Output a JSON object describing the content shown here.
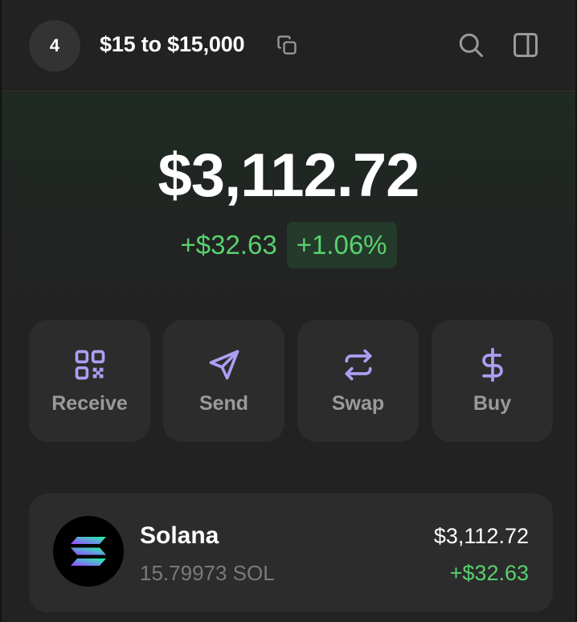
{
  "header": {
    "account_index": "4",
    "account_name": "$15 to $15,000",
    "icons": {
      "copy": "copy-icon",
      "search": "search-icon",
      "panel": "sidebar-panel-icon"
    }
  },
  "balance": {
    "total": "$3,112.72",
    "change_abs": "+$32.63",
    "change_pct": "+1.06%"
  },
  "actions": [
    {
      "label": "Receive",
      "icon": "qr-code-icon"
    },
    {
      "label": "Send",
      "icon": "send-icon"
    },
    {
      "label": "Swap",
      "icon": "swap-icon"
    },
    {
      "label": "Buy",
      "icon": "dollar-icon"
    }
  ],
  "tokens": [
    {
      "name": "Solana",
      "amount": "15.79973 SOL",
      "value": "$3,112.72",
      "change": "+$32.63",
      "icon": "solana-logo-icon"
    }
  ],
  "colors": {
    "accent": "#ab9ff2",
    "positive": "#58d16e",
    "card": "#2c2c2c",
    "background": "#222222"
  }
}
